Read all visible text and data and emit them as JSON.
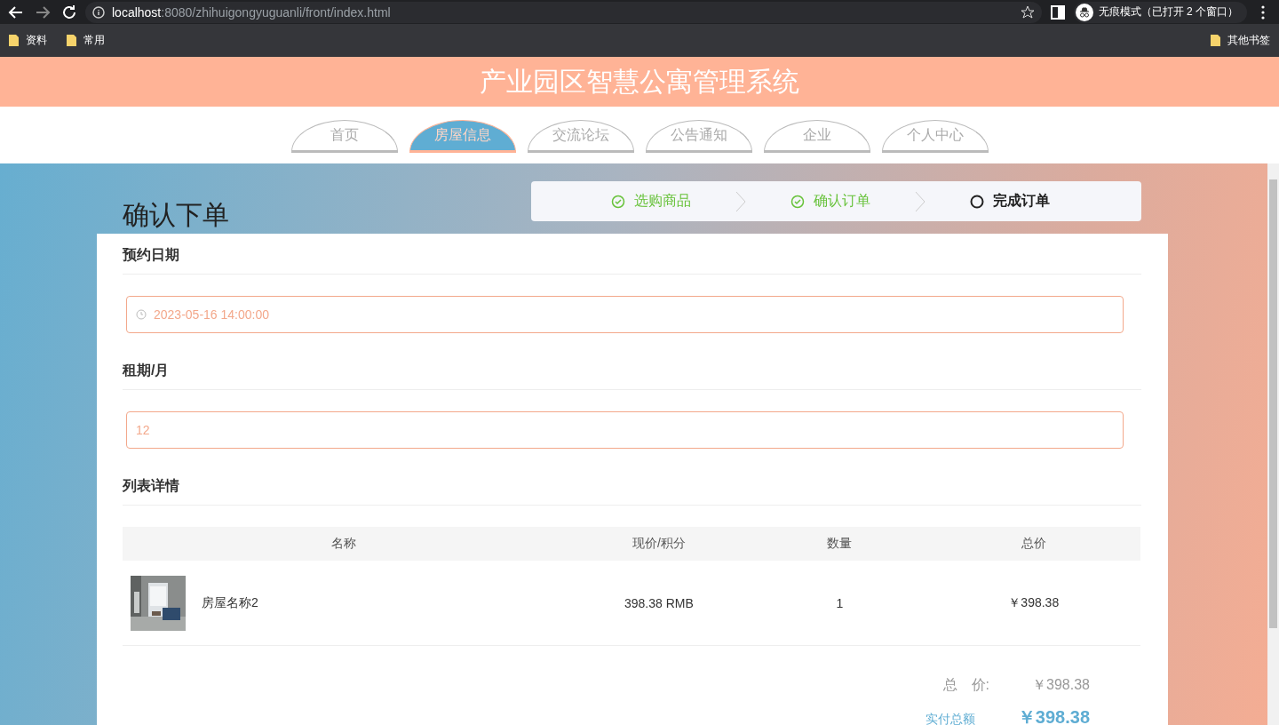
{
  "browser": {
    "url_host": "localhost",
    "url_path": ":8080/zhihuigongyuguanli/front/index.html",
    "profile_label": "无痕模式（已打开 2 个窗口）",
    "bookmarks": [
      "资料",
      "常用"
    ],
    "other_bookmarks": "其他书签"
  },
  "site_title": "产业园区智慧公寓管理系统",
  "nav": [
    {
      "label": "首页",
      "selected": false
    },
    {
      "label": "房屋信息",
      "selected": true
    },
    {
      "label": "交流论坛",
      "selected": false
    },
    {
      "label": "公告通知",
      "selected": false
    },
    {
      "label": "企业",
      "selected": false
    },
    {
      "label": "个人中心",
      "selected": false
    }
  ],
  "page_title": "确认下单",
  "steps": [
    {
      "label": "选购商品",
      "done": true
    },
    {
      "label": "确认订单",
      "done": true
    },
    {
      "label": "完成订单",
      "done": false
    }
  ],
  "form": [
    {
      "label": "预约日期",
      "kind": "datetime",
      "value": "2023-05-16 14:00:00"
    },
    {
      "label": "租期/月",
      "kind": "text",
      "value": "12"
    }
  ],
  "list_title": "列表详情",
  "table": {
    "columns": [
      "名称",
      "现价/积分",
      "数量",
      "总价"
    ],
    "rows": [
      {
        "name": "房屋名称2",
        "price": "398.38 RMB",
        "quantity": "1",
        "total": "￥398.38"
      }
    ]
  },
  "summary": [
    {
      "kind": "total",
      "label": "总　价:",
      "value": "￥398.38"
    },
    {
      "kind": "paid",
      "label": "实付总额",
      "value": "￥398.38"
    }
  ]
}
